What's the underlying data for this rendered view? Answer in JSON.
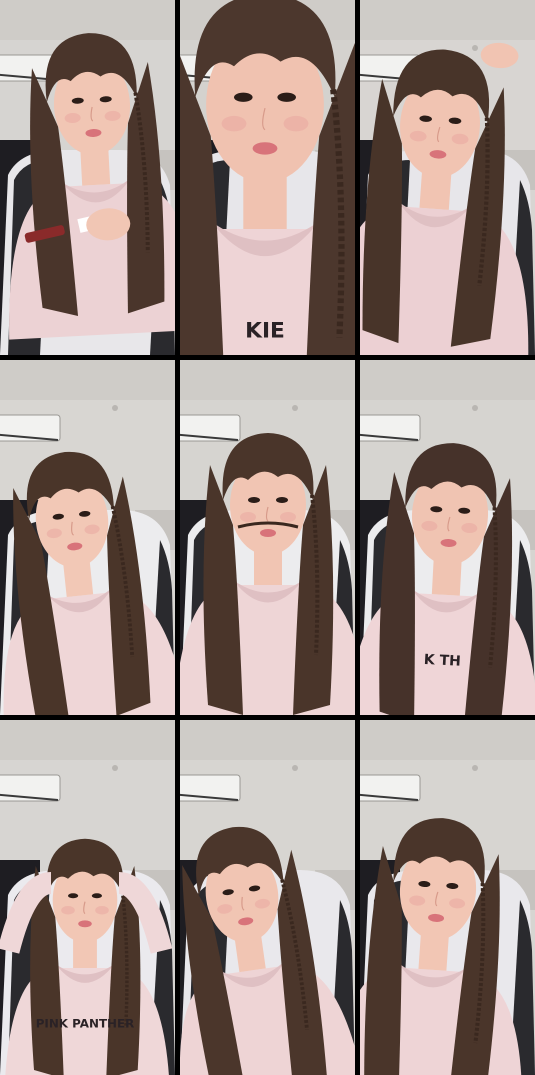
{
  "collage": {
    "rows": 3,
    "cols": 3,
    "frames": [
      {
        "pose": "holding-lip-tint",
        "hoodie_text": "",
        "colors": {
          "wall": "#d6d4d1",
          "hair": "#4a352b",
          "hoodie": "#ecd2d4",
          "skin": "#f1c6b4",
          "chair": "#e8e7ea"
        }
      },
      {
        "pose": "close-up-face",
        "hoodie_text": "KIE",
        "colors": {
          "wall": "#d4d2ce",
          "hair": "#4c372d",
          "hoodie": "#eed4d6",
          "skin": "#f0c2b0",
          "chair": "#e7e6ea"
        }
      },
      {
        "pose": "hand-on-head",
        "hoodie_text": "",
        "colors": {
          "wall": "#d8d5d2",
          "hair": "#483429",
          "hoodie": "#ecd0d3",
          "skin": "#f1c4b2",
          "chair": "#e7e6ea"
        }
      },
      {
        "pose": "pout",
        "hoodie_text": "",
        "colors": {
          "wall": "#d8d6d2",
          "hair": "#4a3529",
          "hoodie": "#efd6d7",
          "skin": "#f2c8b6",
          "chair": "#ececee"
        }
      },
      {
        "pose": "braid-mustache",
        "hoodie_text": "",
        "colors": {
          "wall": "#d6d4d0",
          "hair": "#4a352a",
          "hoodie": "#eed5d6",
          "skin": "#f1c5b3",
          "chair": "#ececee"
        }
      },
      {
        "pose": "side-glance",
        "hoodie_text": "K TH",
        "colors": {
          "wall": "#d6d4d0",
          "hair": "#46322a",
          "hoodie": "#efd5d7",
          "skin": "#f0c4b2",
          "chair": "#ececee"
        }
      },
      {
        "pose": "hands-behind-head",
        "hoodie_text": "PINK PANTHER",
        "colors": {
          "wall": "#d7d5d2",
          "hair": "#4a3529",
          "hoodie": "#efd7d8",
          "skin": "#f2c7b5",
          "chair": "#ebeaee"
        }
      },
      {
        "pose": "profile-pout",
        "hoodie_text": "",
        "colors": {
          "wall": "#d7d5d1",
          "hair": "#4b362b",
          "hoodie": "#eed4d5",
          "skin": "#f1c5b3",
          "chair": "#e9e8ec"
        }
      },
      {
        "pose": "smile",
        "hoodie_text": "",
        "colors": {
          "wall": "#d7d5d1",
          "hair": "#4a352a",
          "hoodie": "#eed4d6",
          "skin": "#f2c6b4",
          "chair": "#e9e8ec"
        }
      }
    ]
  }
}
